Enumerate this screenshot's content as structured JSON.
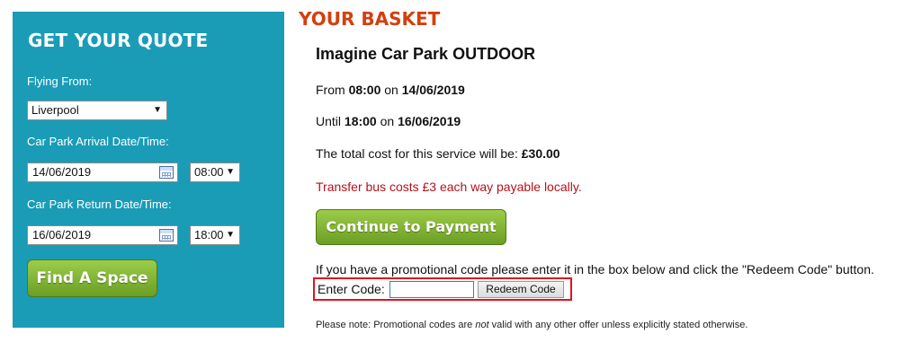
{
  "quote": {
    "title": "GET YOUR QUOTE",
    "flying_from_label": "Flying From:",
    "flying_from_value": "Liverpool",
    "arrival_label": "Car Park Arrival Date/Time:",
    "arrival_date": "14/06/2019",
    "arrival_time": "08:00",
    "return_label": "Car Park Return Date/Time:",
    "return_date": "16/06/2019",
    "return_time": "18:00",
    "find_button": "Find A Space"
  },
  "basket": {
    "heading": "YOUR BASKET",
    "product": "Imagine Car Park OUTDOOR",
    "from_prefix": "From ",
    "from_time": "08:00",
    "from_on": " on ",
    "from_date": "14/06/2019",
    "until_prefix": "Until ",
    "until_time": "18:00",
    "until_on": " on ",
    "until_date": "16/06/2019",
    "total_text": "The total cost for this service will be: ",
    "total_amount": "£30.00",
    "transfer_note": "Transfer bus costs £3 each way payable locally.",
    "pay_button": "Continue to Payment",
    "promo_instructions": "If you have a promotional code please enter it in the box below and click the \"Redeem Code\" button.",
    "promo_label": "Enter Code:",
    "promo_value": "",
    "redeem_button": "Redeem Code",
    "note_prefix": "Please note: Promotional codes are ",
    "note_emph": "not",
    "note_suffix": " valid with any other offer unless explicitly stated otherwise."
  },
  "icons": {
    "dropdown": "chevron-down-icon",
    "calendar": "calendar-icon"
  },
  "colors": {
    "panel": "#1a9cb7",
    "heading": "#d43f0f",
    "button_green": "#7fb234",
    "warning": "#b3121b",
    "highlight": "#e0141e"
  }
}
